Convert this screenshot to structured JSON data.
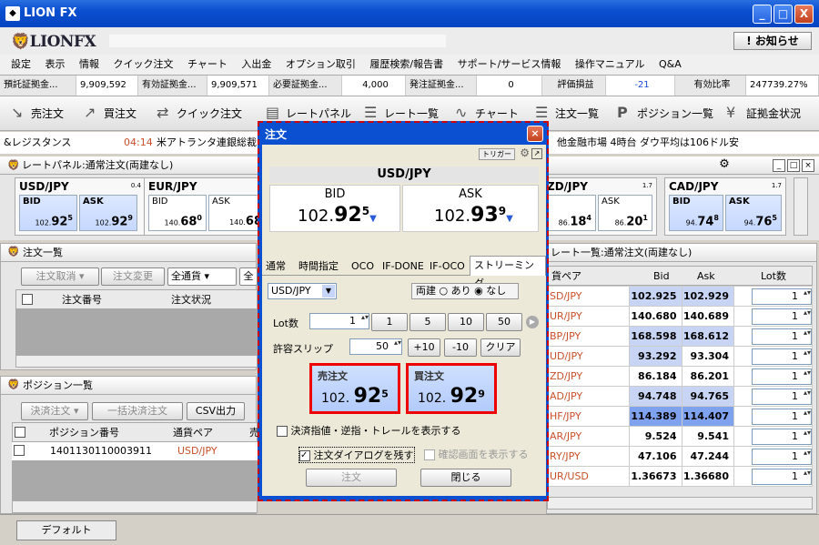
{
  "window": {
    "title": "LION FX",
    "minimize": "_",
    "maximize": "□",
    "close": "X"
  },
  "logo": "LIONFX",
  "notify": "! お知らせ",
  "menu": [
    "設定",
    "表示",
    "情報",
    "クイック注文",
    "チャート",
    "入出金",
    "オプション取引",
    "履歴検索/報告書",
    "サポート/サービス情報",
    "操作マニュアル",
    "Q&A"
  ],
  "account": [
    {
      "label": "預託証拠金...",
      "value": "9,909,592"
    },
    {
      "label": "有効証拠金...",
      "value": "9,909,571"
    },
    {
      "label": "必要証拠金...",
      "value": "4,000"
    },
    {
      "label": "発注証拠金...",
      "value": "0"
    },
    {
      "label": "評価損益",
      "value": "-21"
    },
    {
      "label": "有効比率",
      "value": "247739.27%"
    }
  ],
  "toolbar": [
    "売注文",
    "買注文",
    "クイック注文",
    "レートパネル",
    "レート一覧",
    "チャート",
    "注文一覧",
    "ポジション一覧",
    "証拠金状況"
  ],
  "news": {
    "left": "&レジスタンス",
    "time": "04:14",
    "headline": "米アトランタ連銀総裁",
    "right": "他金融市場 4時台 ダウ平均は106ドル安"
  },
  "rate_panel": {
    "title": "レートパネル:通常注文(両建なし)",
    "cards": [
      {
        "pair": "USD/JPY",
        "lot": "0.4",
        "bid_pre": "102.",
        "bid_big": "92",
        "bid_sub": "5",
        "ask_pre": "102.",
        "ask_big": "92",
        "ask_sub": "9"
      },
      {
        "pair": "EUR/JPY",
        "lot": "0",
        "bid_pre": "140.",
        "bid_big": "68",
        "bid_sub": "0",
        "ask_pre": "140.",
        "ask_big": "68",
        "ask_sub": ""
      },
      {
        "pair": "ZD/JPY",
        "lot": "1.7",
        "bid_pre": "",
        "bid_big": "",
        "bid_sub": "",
        "ask_pre": "86.",
        "ask_big": "20",
        "ask_sub": "1"
      },
      {
        "pair": "CAD/JPY",
        "lot": "1.7",
        "bid_pre": "94.",
        "bid_big": "74",
        "bid_sub": "8",
        "ask_pre": "94.",
        "ask_big": "76",
        "ask_sub": "5"
      }
    ],
    "bid": "BID",
    "ask": "ASK",
    "ask2_pre": "86.",
    "ask2_big": "18",
    "ask2_sub": "4"
  },
  "order_list": {
    "title": "注文一覧",
    "cancel": "注文取消",
    "change": "注文変更",
    "filter": "全通貨",
    "filter2": "全",
    "cols": [
      "注文番号",
      "注文状況"
    ]
  },
  "position_list": {
    "title": "ポジション一覧",
    "settle": "決済注文",
    "bulk": "一括決済注文",
    "csv": "CSV出力",
    "cols": [
      "ポジション番号",
      "通貨ペア",
      "売"
    ],
    "rows": [
      {
        "id": "1401130110003911",
        "pair": "USD/JPY"
      }
    ]
  },
  "rate_list": {
    "title": "レート一覧:通常注文(両建なし)",
    "cols": [
      "貨ペア",
      "Bid",
      "Ask",
      "Lot数"
    ],
    "rows": [
      {
        "pair": "SD/JPY",
        "bid": "102.925",
        "ask": "102.929",
        "lot": "1"
      },
      {
        "pair": "UR/JPY",
        "bid": "140.680",
        "ask": "140.689",
        "lot": "1"
      },
      {
        "pair": "BP/JPY",
        "bid": "168.598",
        "ask": "168.612",
        "lot": "1"
      },
      {
        "pair": "UD/JPY",
        "bid": "93.292",
        "ask": "93.304",
        "lot": "1"
      },
      {
        "pair": "ZD/JPY",
        "bid": "86.184",
        "ask": "86.201",
        "lot": "1"
      },
      {
        "pair": "AD/JPY",
        "bid": "94.748",
        "ask": "94.765",
        "lot": "1"
      },
      {
        "pair": "HF/JPY",
        "bid": "114.389",
        "ask": "114.407",
        "lot": "1"
      },
      {
        "pair": "AR/JPY",
        "bid": "9.524",
        "ask": "9.541",
        "lot": "1"
      },
      {
        "pair": "RY/JPY",
        "bid": "47.106",
        "ask": "47.244",
        "lot": "1"
      },
      {
        "pair": "UR/USD",
        "bid": "1.36673",
        "ask": "1.36680",
        "lot": "1"
      }
    ]
  },
  "tab_default": "デフォルト",
  "dialog": {
    "title": "注文",
    "trigger": "トリガー",
    "pair": "USD/JPY",
    "bid_label": "BID",
    "bid_pre": "102.",
    "bid_big": "92",
    "bid_sub": "5",
    "ask_label": "ASK",
    "ask_pre": "102.",
    "ask_big": "93",
    "ask_sub": "9",
    "tabs": [
      "通常",
      "時間指定",
      "OCO",
      "IF-DONE",
      "IF-OCO",
      "ストリーミング"
    ],
    "pair_select": "USD/JPY",
    "hedge_label": "両建",
    "hedge_yes": "あり",
    "hedge_no": "なし",
    "lot_label": "Lot数",
    "lot_value": "1",
    "lot_presets": [
      "1",
      "5",
      "10",
      "50"
    ],
    "slip_label": "許容スリップ",
    "slip_value": "50",
    "slip_plus": "+10",
    "slip_minus": "-10",
    "clear": "クリア",
    "sell_label": "売注文",
    "sell_pre": "102.",
    "sell_big": "92",
    "sell_sub": "5",
    "buy_label": "買注文",
    "buy_pre": "102.",
    "buy_big": "92",
    "buy_sub": "9",
    "show_settle": "決済指値・逆指・トレールを表示する",
    "keep_dialog": "注文ダイアログを残す",
    "confirm": "確認画面を表示する",
    "order_btn": "注文",
    "close_btn": "閉じる"
  }
}
